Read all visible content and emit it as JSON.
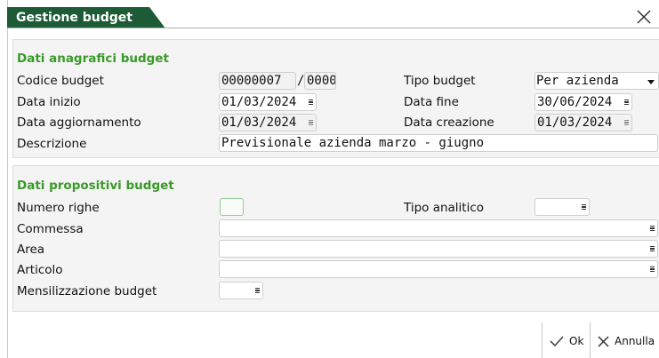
{
  "window": {
    "title": "Gestione budget"
  },
  "section_anagrafici": {
    "title": "Dati anagrafici budget",
    "codice_budget_label": "Codice budget",
    "codice_budget_value": "00000007",
    "codice_budget_sep": "/",
    "codice_budget_suffix": "0000",
    "tipo_budget_label": "Tipo budget",
    "tipo_budget_value": "Per azienda",
    "data_inizio_label": "Data inizio",
    "data_inizio_value": "01/03/2024",
    "data_fine_label": "Data fine",
    "data_fine_value": "30/06/2024",
    "data_aggiornamento_label": "Data aggiornamento",
    "data_aggiornamento_value": "01/03/2024",
    "data_creazione_label": "Data creazione",
    "data_creazione_value": "01/03/2024",
    "descrizione_label": "Descrizione",
    "descrizione_value": "Previsionale azienda marzo - giugno"
  },
  "section_propositivi": {
    "title": "Dati propositivi budget",
    "numero_righe_label": "Numero righe",
    "numero_righe_value": "",
    "tipo_analitico_label": "Tipo analitico",
    "tipo_analitico_value": "",
    "commessa_label": "Commessa",
    "commessa_value": "",
    "area_label": "Area",
    "area_value": "",
    "articolo_label": "Articolo",
    "articolo_value": "",
    "mensilizzazione_label": "Mensilizzazione budget",
    "mensilizzazione_value": ""
  },
  "footer": {
    "ok_label": "Ok",
    "annulla_label": "Annulla"
  },
  "colors": {
    "title_bg": "#1d5a36",
    "section_title": "#3a9a2a",
    "panel_bg": "#f4f4f4"
  }
}
